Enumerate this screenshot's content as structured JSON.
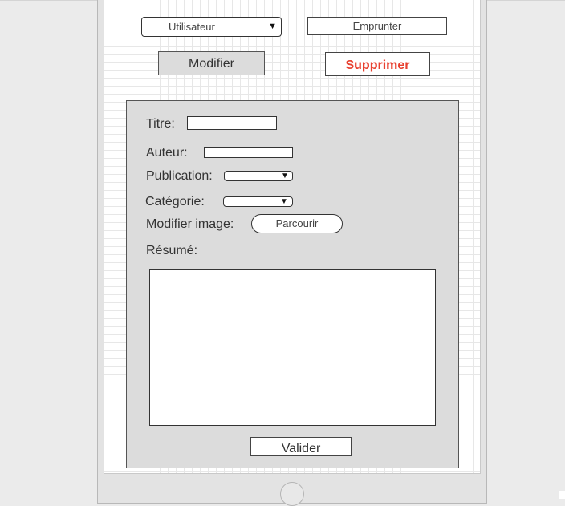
{
  "toolbar": {
    "user_select_value": "Utilisateur",
    "borrow_label": "Emprunter",
    "modify_label": "Modifier",
    "delete_label": "Supprimer"
  },
  "form": {
    "title_label": "Titre:",
    "title_value": "",
    "author_label": "Auteur:",
    "author_value": "",
    "publication_label": "Publication:",
    "publication_value": "",
    "category_label": "Catégorie:",
    "category_value": "",
    "image_label": "Modifier image:",
    "browse_label": "Parcourir",
    "summary_label": "Résumé:",
    "summary_value": "",
    "submit_label": "Valider"
  },
  "icons": {
    "dropdown": "triangle-down-icon"
  },
  "colors": {
    "delete_text": "#e8402f",
    "panel_bg": "#dcdcdc",
    "modify_bg": "#dcdcdc"
  }
}
